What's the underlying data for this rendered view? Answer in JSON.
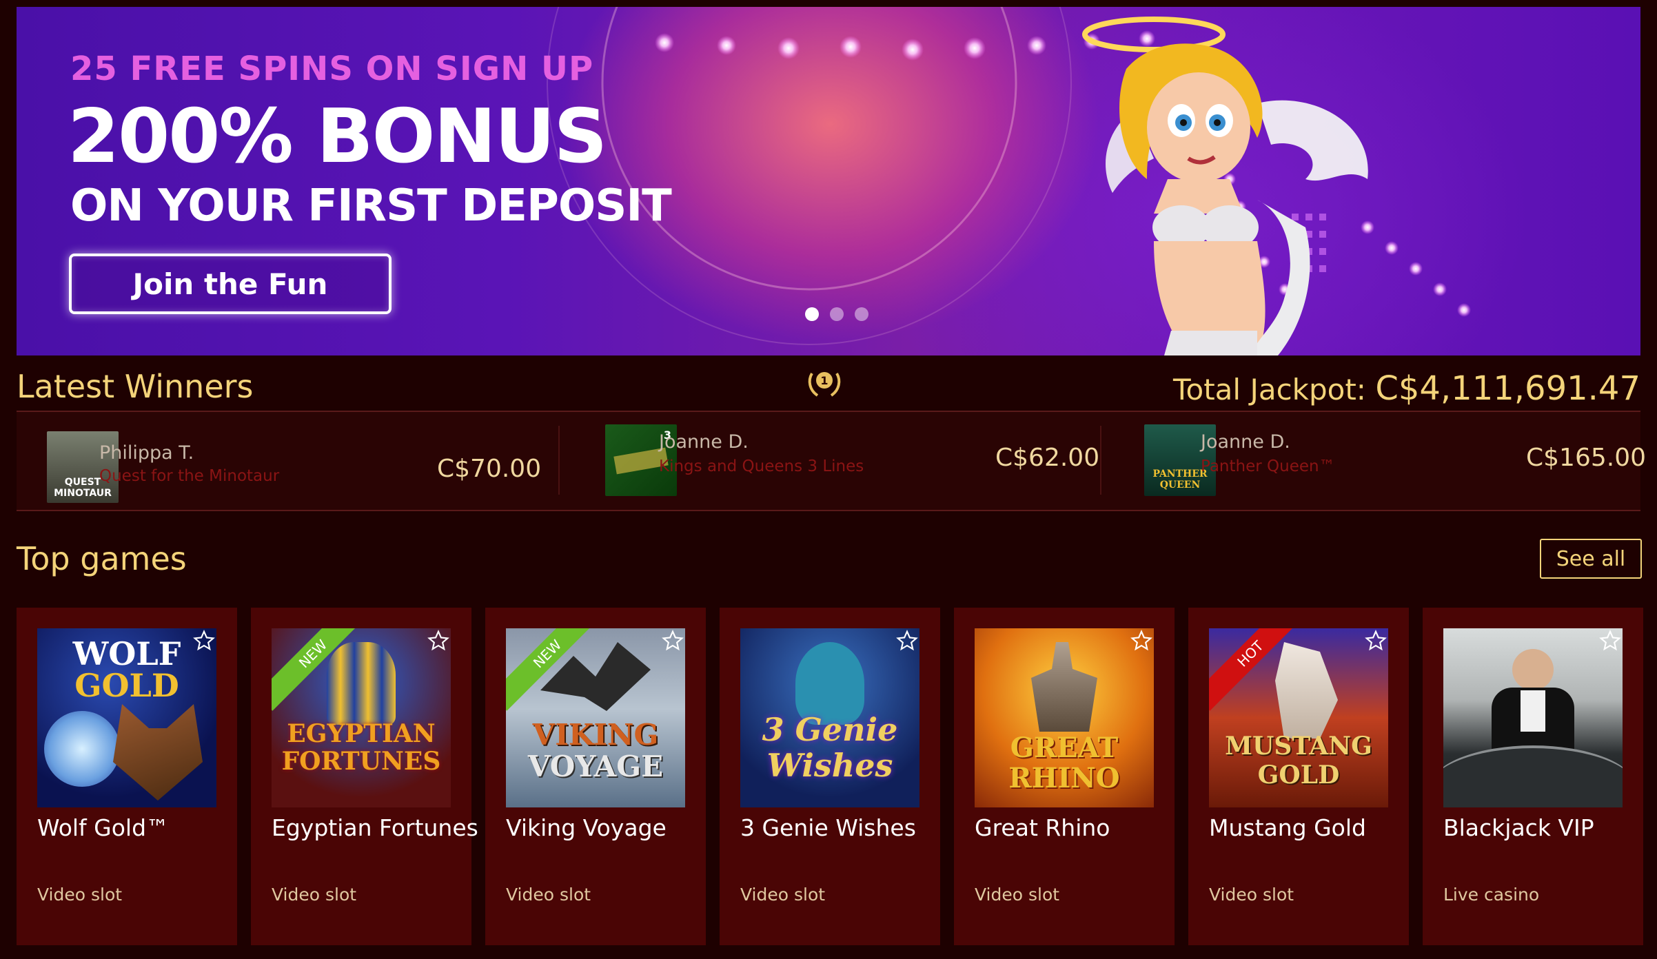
{
  "hero": {
    "subtitle": "25 FREE SPINS ON SIGN UP",
    "title": "200% BONUS",
    "title_line2": "ON YOUR FIRST DEPOSIT",
    "cta": "Join the Fun",
    "slide_count": 3,
    "active_slide": 1
  },
  "winners": {
    "title": "Latest Winners",
    "jackpot_label": "Total Jackpot:",
    "jackpot_amount": "C$4,111,691.47",
    "laurel_rank": "1",
    "items": [
      {
        "name": "Philippa T.",
        "game": "Quest for the Minotaur",
        "prize": "C$70.00",
        "thumb_text": "QUEST MINOTAUR"
      },
      {
        "name": "Joanne D.",
        "game": "Kings and Queens 3 Lines",
        "prize": "C$62.00",
        "thumb_text": "3"
      },
      {
        "name": "Joanne D.",
        "game": "Panther Queen™",
        "prize": "C$165.00",
        "thumb_text": "PANTHER QUEEN"
      }
    ]
  },
  "top_games": {
    "title": "Top games",
    "see_all": "See all",
    "games": [
      {
        "title": "Wolf Gold™",
        "category": "Video slot",
        "art_line1": "WOLF",
        "art_line2": "GOLD",
        "badge": ""
      },
      {
        "title": "Egyptian Fortunes",
        "category": "Video slot",
        "art_line1": "EGYPTIAN",
        "art_line2": "FORTUNES",
        "badge": "NEW"
      },
      {
        "title": "Viking Voyage",
        "category": "Video slot",
        "art_line1": "VIKING",
        "art_line2": "VOYAGE",
        "badge": "NEW"
      },
      {
        "title": "3 Genie Wishes",
        "category": "Video slot",
        "art_line1": "3 Genie",
        "art_line2": "Wishes",
        "badge": ""
      },
      {
        "title": "Great Rhino",
        "category": "Video slot",
        "art_line1": "GREAT",
        "art_line2": "RHINO",
        "badge": ""
      },
      {
        "title": "Mustang Gold",
        "category": "Video slot",
        "art_line1": "MUSTANG",
        "art_line2": "GOLD",
        "badge": "HOT"
      },
      {
        "title": "Blackjack VIP",
        "category": "Live casino",
        "art_line1": "",
        "art_line2": "",
        "badge": ""
      }
    ]
  },
  "colors": {
    "background": "#1e0101",
    "gold": "#f4d47a",
    "card": "#4a0505",
    "hero_pink": "#e560e0",
    "badge_new": "#6cbf2a",
    "badge_hot": "#d01010"
  },
  "icons": [
    "laurel-icon",
    "star-icon",
    "carousel-dot"
  ]
}
